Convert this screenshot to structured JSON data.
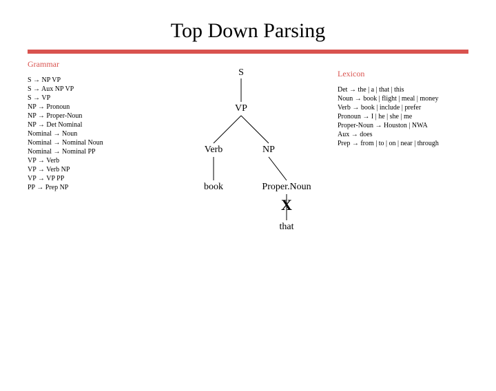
{
  "title": "Top Down Parsing",
  "grammar": {
    "header": "Grammar",
    "rules": [
      "S → NP VP",
      "S → Aux NP VP",
      "S → VP",
      "NP → Pronoun",
      "NP → Proper-Noun",
      "NP → Det Nominal",
      "Nominal → Noun",
      "Nominal → Nominal Noun",
      "Nominal → Nominal PP",
      "VP → Verb",
      "VP → Verb NP",
      "VP → VP PP",
      "PP → Prep NP"
    ]
  },
  "lexicon": {
    "header": "Lexicon",
    "entries": [
      "Det → the | a | that | this",
      "Noun → book | flight | meal | money",
      "Verb → book | include | prefer",
      "Pronoun → I | he | she | me",
      "Proper-Noun → Houston | NWA",
      "Aux → does",
      "Prep → from | to | on | near | through"
    ]
  },
  "tree": {
    "s": "S",
    "vp": "VP",
    "verb": "Verb",
    "np": "NP",
    "book": "book",
    "propernoun": "Proper.Noun",
    "x": "X",
    "that": "that"
  }
}
